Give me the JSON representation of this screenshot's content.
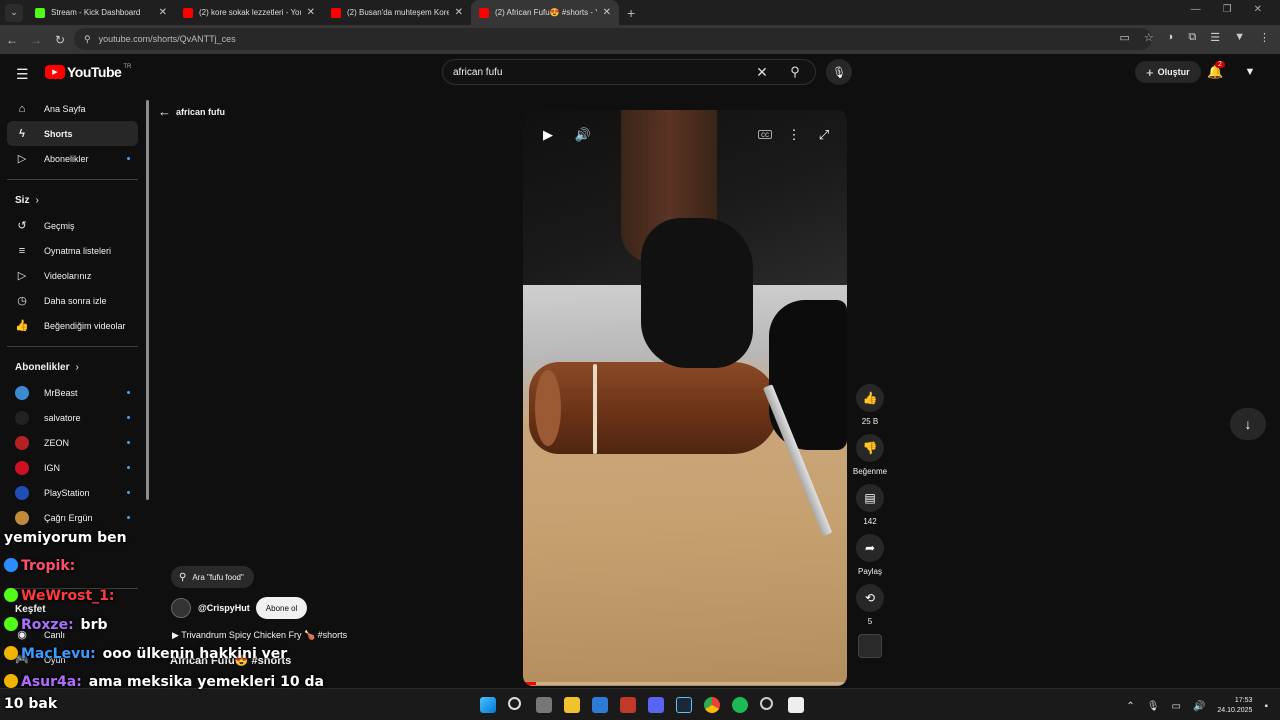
{
  "browser": {
    "tabs": [
      {
        "title": "Stream - Kick Dashboard",
        "color": "#53fc18",
        "active": false
      },
      {
        "title": "(2) kore sokak lezzetleri - YouTube",
        "color": "#ff0000",
        "active": false
      },
      {
        "title": "(2) Busan'da muhteşem Kore sokak",
        "color": "#ff0000",
        "active": false
      },
      {
        "title": "(2) African Fufu😍 #shorts - YouTube",
        "color": "#ff0000",
        "active": true
      }
    ],
    "new_tab": "+",
    "url": "youtube.com/shorts/QvANTTj_ces"
  },
  "masthead": {
    "logo_text": "YouTube",
    "region": "TR",
    "search_value": "african fufu",
    "create_label": "Oluştur",
    "notif_count": "2"
  },
  "sidebar": {
    "main": [
      {
        "label": "Ana Sayfa",
        "icon": "home-icon",
        "glyph": "⌂"
      },
      {
        "label": "Shorts",
        "icon": "shorts-icon",
        "glyph": "ϟ"
      },
      {
        "label": "Abonelikler",
        "icon": "subscriptions-icon",
        "glyph": "▷"
      }
    ],
    "you_header": "Siz",
    "you": [
      {
        "label": "Geçmiş",
        "glyph": "↺"
      },
      {
        "label": "Oynatma listeleri",
        "glyph": "≡"
      },
      {
        "label": "Videolarınız",
        "glyph": "▷"
      },
      {
        "label": "Daha sonra izle",
        "glyph": "◷"
      },
      {
        "label": "Beğendiğim videolar",
        "glyph": "👍"
      }
    ],
    "subs_header": "Abonelikler",
    "subs": [
      {
        "label": "MrBeast",
        "color": "#3a8bd0"
      },
      {
        "label": "salvatore",
        "color": "#222222"
      },
      {
        "label": "ZEON",
        "color": "#b22222"
      },
      {
        "label": "IGN",
        "color": "#cc1122"
      },
      {
        "label": "PlayStation",
        "color": "#1f4fb4"
      },
      {
        "label": "Çağrı Ergün",
        "color": "#c08a3a"
      }
    ],
    "explore_header": "Keşfet",
    "explore": [
      {
        "label": "Canlı"
      },
      {
        "label": "Oyun"
      }
    ]
  },
  "shorts": {
    "back_label": "african fufu",
    "search_pill": "Ara \"fufu food\"",
    "channel": "@CrispyHut",
    "subscribe": "Abone ol",
    "music": "▶  Trivandrum Spicy Chicken Fry 🍗 #shorts",
    "title": "African Fufu😍 #shorts",
    "actions": [
      {
        "name": "like",
        "glyph": "👍",
        "label": "25 B"
      },
      {
        "name": "dislike",
        "glyph": "👎",
        "label": "Beğenme"
      },
      {
        "name": "comments",
        "glyph": "▤",
        "label": "142"
      },
      {
        "name": "share",
        "glyph": "➦",
        "label": "Paylaş"
      },
      {
        "name": "remix",
        "glyph": "⟲",
        "label": "5"
      }
    ],
    "progress": 0.04
  },
  "chat": [
    {
      "user": "",
      "text": "yemiyorum ben",
      "color": "#ffffff"
    },
    {
      "user": "Tropik:",
      "text": "",
      "color": "#ff4d6d"
    },
    {
      "user": "WeWrost_1:",
      "text": "",
      "color": "#ff3b3b"
    },
    {
      "user": "Roxze:",
      "text": "brb",
      "color": "#a970ff"
    },
    {
      "user": "MacLevu:",
      "text": "ooo ülkenin hakkini ver",
      "color": "#3b9cff"
    },
    {
      "user": "Asur4a:",
      "text": "ama meksika yemekleri 10 da",
      "color": "#b06cff"
    },
    {
      "user": "",
      "text": "10 bak",
      "color": "#ffffff"
    }
  ],
  "clock": {
    "time": "17:53",
    "date": "24.10.2025"
  }
}
